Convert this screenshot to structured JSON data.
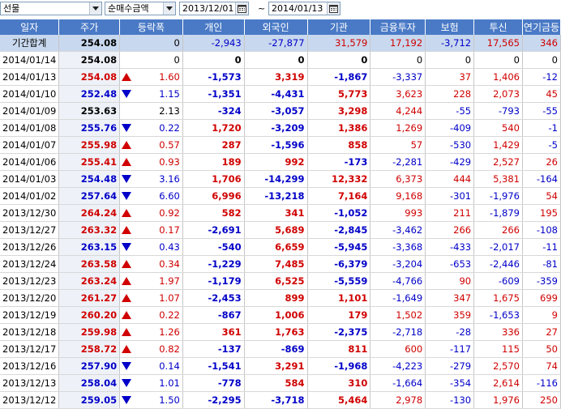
{
  "toolbar": {
    "market": "선물",
    "metric": "순매수금액",
    "start_date": "2013/12/01",
    "separator": "~",
    "end_date": "2014/01/13"
  },
  "columns": [
    "일자",
    "주가",
    "등락폭",
    "개인",
    "외국인",
    "기관",
    "금융투자",
    "보험",
    "투신",
    "연기금등"
  ],
  "summary": {
    "label": "기간합계",
    "price": "254.08",
    "change": "0",
    "individual": "-2,943",
    "foreign": "-27,877",
    "institution": "31,579",
    "fin_invest": "17,192",
    "insurance": "-3,712",
    "trust": "17,565",
    "pension": "346"
  },
  "rows": [
    {
      "date": "2014/01/14",
      "price": "254.08",
      "dir": "none",
      "change": "0",
      "individual": "0",
      "foreign": "0",
      "institution": "0",
      "fin_invest": "0",
      "insurance": "0",
      "trust": "0",
      "pension": "0"
    },
    {
      "date": "2014/01/13",
      "price": "254.08",
      "dir": "up",
      "change": "1.60",
      "individual": "-1,573",
      "foreign": "3,319",
      "institution": "-1,867",
      "fin_invest": "-3,337",
      "insurance": "37",
      "trust": "1,406",
      "pension": "-12"
    },
    {
      "date": "2014/01/10",
      "price": "252.48",
      "dir": "dn",
      "change": "1.15",
      "individual": "-1,351",
      "foreign": "-4,431",
      "institution": "5,773",
      "fin_invest": "3,623",
      "insurance": "228",
      "trust": "2,073",
      "pension": "45"
    },
    {
      "date": "2014/01/09",
      "price": "253.63",
      "dir": "none",
      "change": "2.13",
      "individual": "-324",
      "foreign": "-3,057",
      "institution": "3,298",
      "fin_invest": "4,244",
      "insurance": "-55",
      "trust": "-793",
      "pension": "-55"
    },
    {
      "date": "2014/01/08",
      "price": "255.76",
      "dir": "dn",
      "change": "0.22",
      "individual": "1,720",
      "foreign": "-3,209",
      "institution": "1,386",
      "fin_invest": "1,269",
      "insurance": "-409",
      "trust": "540",
      "pension": "-1"
    },
    {
      "date": "2014/01/07",
      "price": "255.98",
      "dir": "up",
      "change": "0.57",
      "individual": "287",
      "foreign": "-1,596",
      "institution": "858",
      "fin_invest": "57",
      "insurance": "-530",
      "trust": "1,429",
      "pension": "-5"
    },
    {
      "date": "2014/01/06",
      "price": "255.41",
      "dir": "up",
      "change": "0.93",
      "individual": "189",
      "foreign": "992",
      "institution": "-173",
      "fin_invest": "-2,281",
      "insurance": "-429",
      "trust": "2,527",
      "pension": "26"
    },
    {
      "date": "2014/01/03",
      "price": "254.48",
      "dir": "dn",
      "change": "3.16",
      "individual": "1,706",
      "foreign": "-14,299",
      "institution": "12,332",
      "fin_invest": "6,373",
      "insurance": "444",
      "trust": "5,381",
      "pension": "-164"
    },
    {
      "date": "2014/01/02",
      "price": "257.64",
      "dir": "dn",
      "change": "6.60",
      "individual": "6,996",
      "foreign": "-13,218",
      "institution": "7,164",
      "fin_invest": "9,168",
      "insurance": "-301",
      "trust": "-1,976",
      "pension": "54"
    },
    {
      "date": "2013/12/30",
      "price": "264.24",
      "dir": "up",
      "change": "0.92",
      "individual": "582",
      "foreign": "341",
      "institution": "-1,052",
      "fin_invest": "993",
      "insurance": "211",
      "trust": "-1,879",
      "pension": "195"
    },
    {
      "date": "2013/12/27",
      "price": "263.32",
      "dir": "up",
      "change": "0.17",
      "individual": "-2,691",
      "foreign": "5,689",
      "institution": "-2,845",
      "fin_invest": "-3,462",
      "insurance": "266",
      "trust": "266",
      "pension": "-108"
    },
    {
      "date": "2013/12/26",
      "price": "263.15",
      "dir": "dn",
      "change": "0.43",
      "individual": "-540",
      "foreign": "6,659",
      "institution": "-5,945",
      "fin_invest": "-3,368",
      "insurance": "-433",
      "trust": "-2,017",
      "pension": "-11"
    },
    {
      "date": "2013/12/24",
      "price": "263.58",
      "dir": "up",
      "change": "0.34",
      "individual": "-1,229",
      "foreign": "7,485",
      "institution": "-6,379",
      "fin_invest": "-3,204",
      "insurance": "-653",
      "trust": "-2,446",
      "pension": "-81"
    },
    {
      "date": "2013/12/23",
      "price": "263.24",
      "dir": "up",
      "change": "1.97",
      "individual": "-1,179",
      "foreign": "6,525",
      "institution": "-5,559",
      "fin_invest": "-4,766",
      "insurance": "90",
      "trust": "-609",
      "pension": "-359"
    },
    {
      "date": "2013/12/20",
      "price": "261.27",
      "dir": "up",
      "change": "1.07",
      "individual": "-2,453",
      "foreign": "899",
      "institution": "1,101",
      "fin_invest": "-1,649",
      "insurance": "347",
      "trust": "1,675",
      "pension": "699"
    },
    {
      "date": "2013/12/19",
      "price": "260.20",
      "dir": "up",
      "change": "0.22",
      "individual": "-867",
      "foreign": "1,006",
      "institution": "179",
      "fin_invest": "1,502",
      "insurance": "359",
      "trust": "-1,653",
      "pension": "9"
    },
    {
      "date": "2013/12/18",
      "price": "259.98",
      "dir": "up",
      "change": "1.26",
      "individual": "361",
      "foreign": "1,763",
      "institution": "-2,375",
      "fin_invest": "-2,718",
      "insurance": "-28",
      "trust": "336",
      "pension": "27"
    },
    {
      "date": "2013/12/17",
      "price": "258.72",
      "dir": "up",
      "change": "0.82",
      "individual": "-137",
      "foreign": "-869",
      "institution": "811",
      "fin_invest": "600",
      "insurance": "-117",
      "trust": "115",
      "pension": "50"
    },
    {
      "date": "2013/12/16",
      "price": "257.90",
      "dir": "dn",
      "change": "0.14",
      "individual": "-1,541",
      "foreign": "3,291",
      "institution": "-1,968",
      "fin_invest": "-4,223",
      "insurance": "-279",
      "trust": "2,570",
      "pension": "74"
    },
    {
      "date": "2013/12/13",
      "price": "258.04",
      "dir": "dn",
      "change": "1.01",
      "individual": "-778",
      "foreign": "584",
      "institution": "310",
      "fin_invest": "-1,664",
      "insurance": "-354",
      "trust": "2,614",
      "pension": "-116"
    },
    {
      "date": "2013/12/12",
      "price": "259.05",
      "dir": "dn",
      "change": "1.50",
      "individual": "-2,295",
      "foreign": "-3,718",
      "institution": "5,464",
      "fin_invest": "2,978",
      "insurance": "-130",
      "trust": "1,976",
      "pension": "250"
    }
  ],
  "colors": {
    "up": "#d00000",
    "down": "#0000c8",
    "header": "#4a7ac6",
    "summary_row": "#c8d8ee"
  },
  "icons": {
    "calendar": "calendar-icon",
    "dropdown": "chevron-down-icon",
    "up": "triangle-up-icon",
    "down": "triangle-down-icon"
  }
}
